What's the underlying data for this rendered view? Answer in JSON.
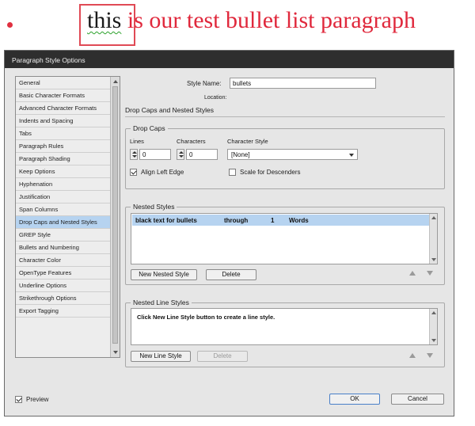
{
  "document": {
    "text_black": "this",
    "text_red": " is our test bullet list paragraph"
  },
  "dialog": {
    "title": "Paragraph Style Options",
    "style_name_label": "Style Name:",
    "style_name_value": "bullets",
    "location_label": "Location:",
    "section_title": "Drop Caps and Nested Styles",
    "categories": [
      {
        "label": "General"
      },
      {
        "label": "Basic Character Formats"
      },
      {
        "label": "Advanced Character Formats"
      },
      {
        "label": "Indents and Spacing"
      },
      {
        "label": "Tabs"
      },
      {
        "label": "Paragraph Rules"
      },
      {
        "label": "Paragraph Shading"
      },
      {
        "label": "Keep Options"
      },
      {
        "label": "Hyphenation"
      },
      {
        "label": "Justification"
      },
      {
        "label": "Span Columns"
      },
      {
        "label": "Drop Caps and Nested Styles"
      },
      {
        "label": "GREP Style"
      },
      {
        "label": "Bullets and Numbering"
      },
      {
        "label": "Character Color"
      },
      {
        "label": "OpenType Features"
      },
      {
        "label": "Underline Options"
      },
      {
        "label": "Strikethrough Options"
      },
      {
        "label": "Export Tagging"
      }
    ],
    "selected_category": "Drop Caps and Nested Styles",
    "drop_caps": {
      "group_label": "Drop Caps",
      "lines_label": "Lines",
      "lines_value": "0",
      "characters_label": "Characters",
      "characters_value": "0",
      "character_style_label": "Character Style",
      "character_style_value": "[None]",
      "align_left_edge_label": "Align Left Edge",
      "align_left_edge_checked": true,
      "scale_descenders_label": "Scale for Descenders",
      "scale_descenders_checked": false
    },
    "nested_styles": {
      "group_label": "Nested Styles",
      "rows": [
        {
          "style": "black text for bullets",
          "mode": "through",
          "count": "1",
          "unit": "Words"
        }
      ],
      "new_button": "New Nested Style",
      "delete_button": "Delete"
    },
    "nested_line_styles": {
      "group_label": "Nested Line Styles",
      "hint": "Click New Line Style button to create a line style.",
      "new_button": "New Line Style",
      "delete_button": "Delete"
    },
    "preview_label": "Preview",
    "preview_checked": true,
    "ok_button": "OK",
    "cancel_button": "Cancel"
  },
  "colors": {
    "doc_red": "#e0283c",
    "selection_blue": "#b6d3f0",
    "highlight_box": "#e04a55"
  }
}
